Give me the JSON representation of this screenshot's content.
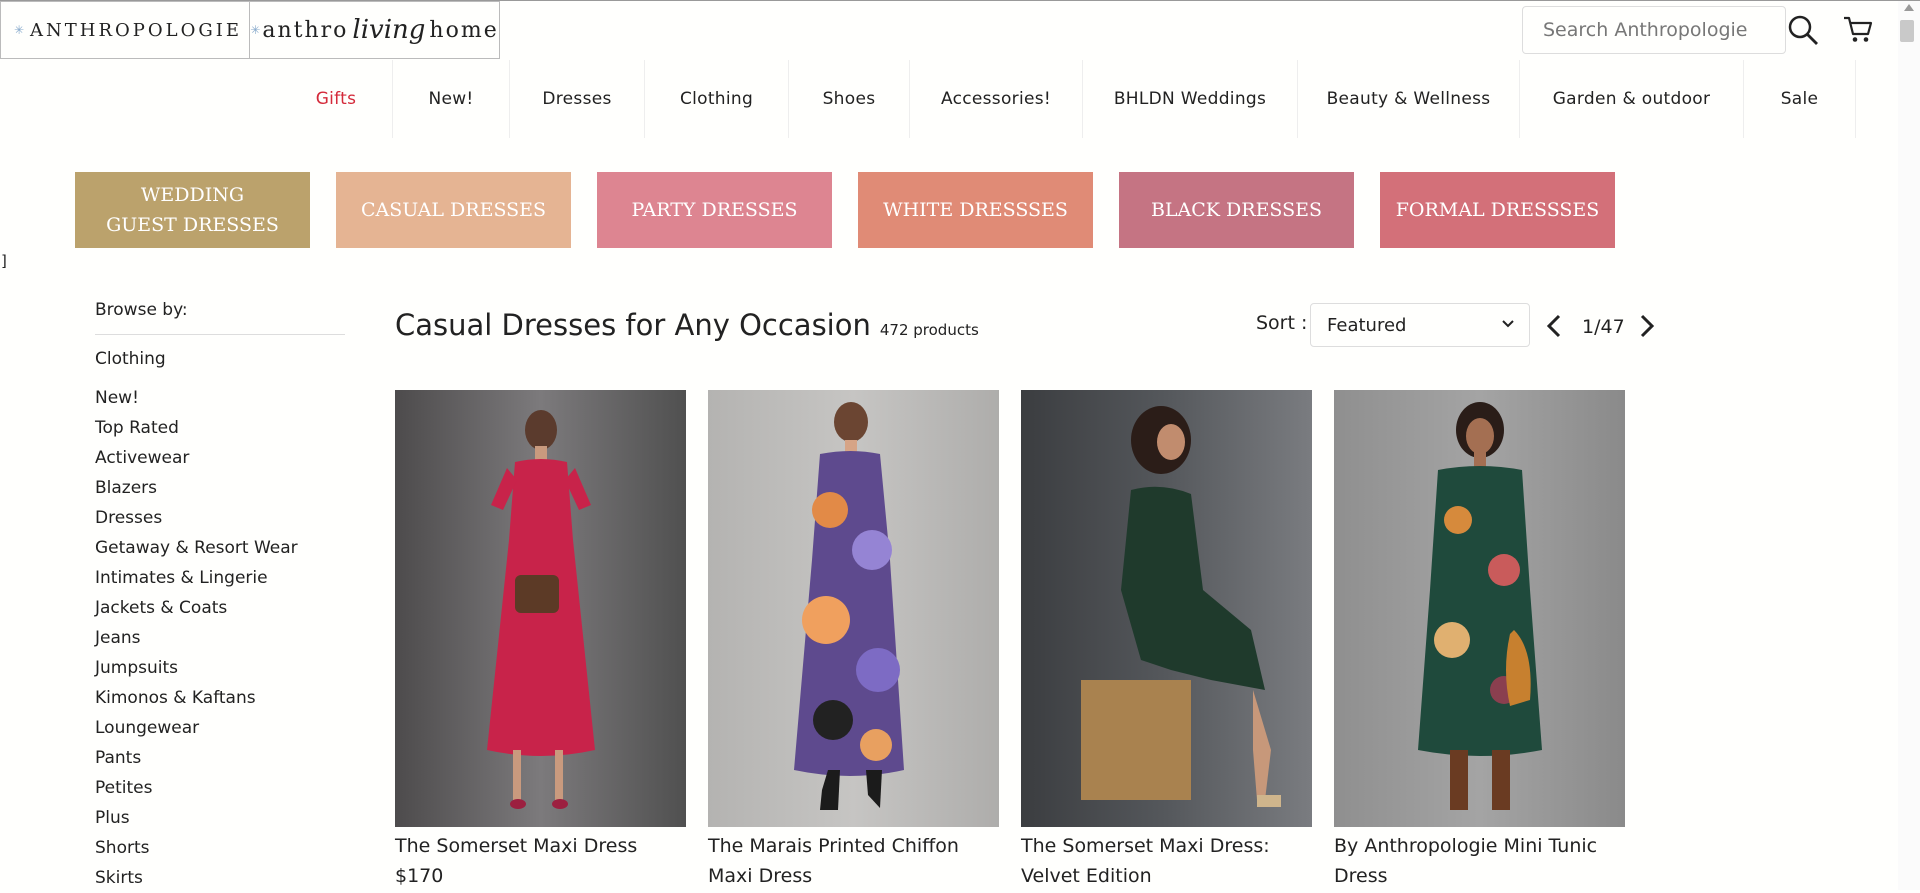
{
  "header": {
    "logo_primary": "ANTHROPOLOGIE",
    "logo_secondary": {
      "anthro": "anthro",
      "living": "living",
      "home": "home"
    },
    "search_placeholder": "Search Anthropologie"
  },
  "nav": [
    {
      "label": "Gifts",
      "color": "#d42a3a"
    },
    {
      "label": "New!"
    },
    {
      "label": "Dresses"
    },
    {
      "label": "Clothing"
    },
    {
      "label": "Shoes"
    },
    {
      "label": "Accessories!"
    },
    {
      "label": "BHLDN Weddings"
    },
    {
      "label": "Beauty & Wellness"
    },
    {
      "label": "Garden & outdoor"
    },
    {
      "label": "Sale"
    }
  ],
  "categories": [
    {
      "label": "WEDDING GUEST DRESSES",
      "color": "#bba26c"
    },
    {
      "label": "CASUAL DRESSES",
      "color": "#e5b493"
    },
    {
      "label": "PARTY DRESSES",
      "color": "#dd8591"
    },
    {
      "label": "WHITE DRESSSES",
      "color": "#e08b76"
    },
    {
      "label": "BLACK DRESSES",
      "color": "#c57483"
    },
    {
      "label": "FORMAL DRESSSES",
      "color": "#d37079"
    }
  ],
  "stray_text": "]",
  "sidebar": {
    "browse_label": "Browse by:",
    "section": "Clothing",
    "items": [
      "New!",
      "Top Rated",
      "Activewear",
      "Blazers",
      "Dresses",
      "Getaway & Resort Wear",
      "Intimates & Lingerie",
      "Jackets & Coats",
      "Jeans",
      "Jumpsuits",
      "Kimonos & Kaftans",
      "Loungewear",
      "Pants",
      "Petites",
      "Plus",
      "Shorts",
      "Skirts"
    ]
  },
  "listing": {
    "title": "Casual Dresses for Any Occasion",
    "count": "472 products",
    "sort_label": "Sort :",
    "sort_value": "Featured",
    "page": "1/47"
  },
  "products": [
    {
      "name": "The Somerset Maxi Dress",
      "price": "$170"
    },
    {
      "name": "The Marais Printed Chiffon Maxi Dress",
      "price": ""
    },
    {
      "name": "The Somerset Maxi Dress: Velvet Edition",
      "price": ""
    },
    {
      "name": "By Anthropologie Mini Tunic Dress",
      "price": ""
    }
  ]
}
